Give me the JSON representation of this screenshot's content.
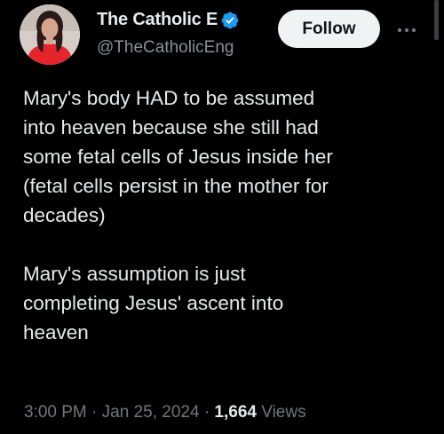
{
  "author": {
    "display_name": "The Catholic E",
    "handle": "@TheCatholicEng",
    "verified_icon": "verified-badge-icon",
    "verified_color": "#1d9bf0"
  },
  "actions": {
    "follow_label": "Follow",
    "more_icon": "more-horizontal-icon"
  },
  "tweet": {
    "paragraphs": [
      "Mary's body HAD to be assumed\ninto heaven because she still had\nsome fetal cells of Jesus inside her\n(fetal cells persist in the mother for\ndecades)",
      "Mary's assumption is just\ncompleting Jesus' ascent into\nheaven"
    ]
  },
  "meta": {
    "time": "3:00 PM",
    "separator": "·",
    "date": "Jan 25, 2024",
    "views_count": "1,664",
    "views_label": "Views"
  },
  "colors": {
    "background": "#000000",
    "text_primary": "#e7e9ea",
    "text_secondary": "#71767b",
    "follow_button_bg": "#eff3f4"
  }
}
